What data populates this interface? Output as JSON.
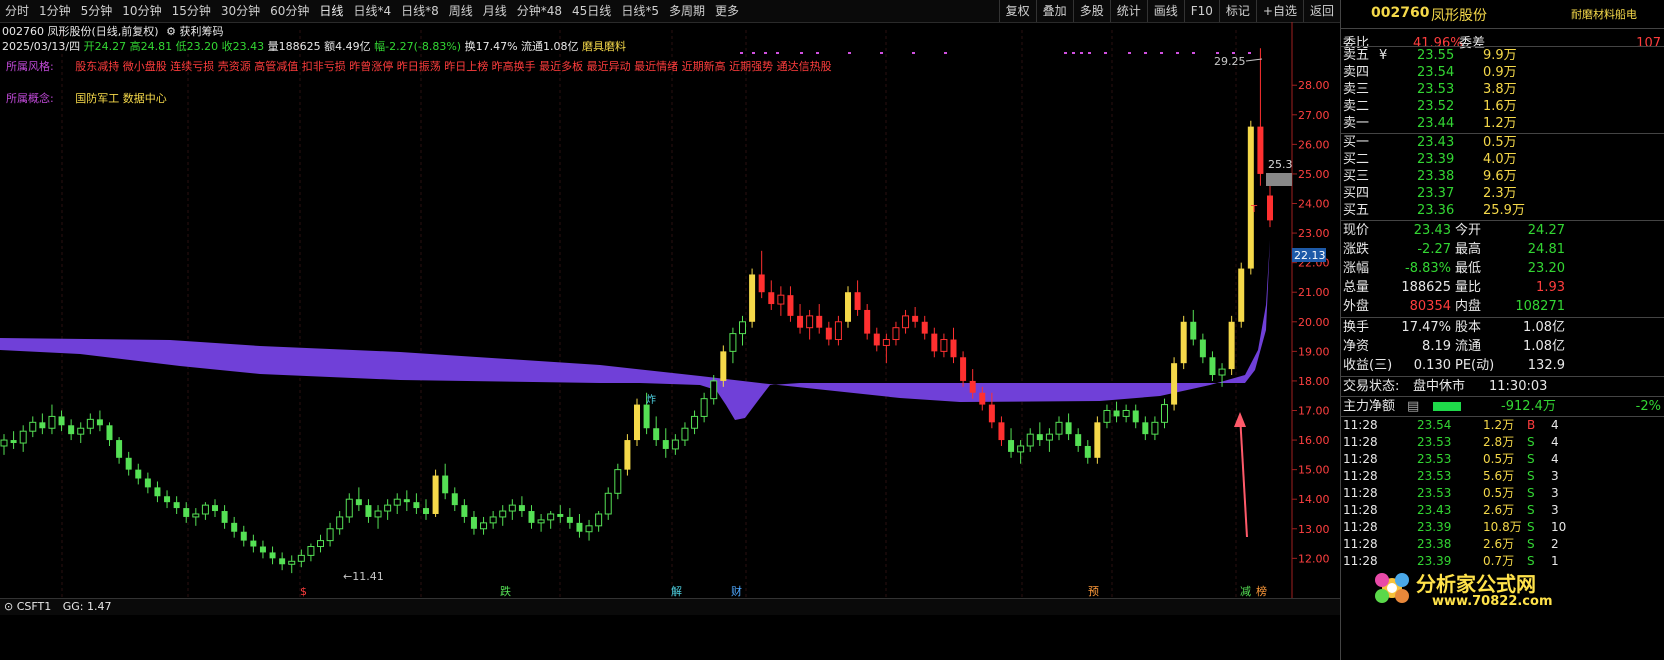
{
  "toolbar": {
    "periods": [
      "分时",
      "1分钟",
      "5分钟",
      "10分钟",
      "15分钟",
      "30分钟",
      "60分钟",
      "日线",
      "日线*4",
      "日线*8",
      "周线",
      "月线",
      "分钟*48",
      "45日线",
      "日线*5",
      "多周期",
      "更多"
    ],
    "tools": [
      "复权",
      "叠加",
      "多股",
      "统计",
      "画线",
      "F10",
      "标记",
      "+自选",
      "返回"
    ]
  },
  "info": {
    "stock": "002760 凤形股份(日线,前复权)",
    "indicator": "获利筹码",
    "date": "2025/03/13/四",
    "open": "开24.27",
    "high": "高24.81",
    "low": "低23.20",
    "close": "收23.43",
    "volume": "量188625",
    "amount": "额4.49亿",
    "change": "幅-2.27(-8.83%)",
    "turnover": "换17.47%",
    "float": "流通1.08亿",
    "sector": "磨具磨料"
  },
  "style_label": "所属风格:",
  "style_tags": "股东减持 微小盘股 连续亏损 壳资源 高管减值 扣非亏损 昨曾涨停 昨日振荡 昨日上榜 昨高换手 最近多板 最近异动 最近情绪 近期新高 近期强势 通达信热股",
  "concept_label": "所属概念:",
  "concept_tags": "国防军工 数据中心",
  "chart_labels": {
    "high_price": "29.25",
    "right_box": "25.3",
    "low_mark": "←11.41",
    "current_price": "22.13",
    "event_s": "$",
    "event_die": "跌",
    "event_jie": "解",
    "event_cai": "财",
    "event_yu": "预",
    "event_jian": "减",
    "event_bang": "榜",
    "zha": "炸",
    "t_mark": "T"
  },
  "chart_data": {
    "type": "candlestick",
    "ylim": [
      11.2,
      29.8
    ],
    "yticks": [
      "28.00",
      "27.00",
      "26.00",
      "25.00",
      "24.00",
      "23.00",
      "22.00",
      "21.00",
      "20.00",
      "19.00",
      "18.00",
      "17.00",
      "16.00",
      "15.00",
      "14.00",
      "13.00",
      "12.00"
    ],
    "ytick_values": [
      28,
      27,
      26,
      25,
      24,
      23,
      22,
      21,
      20,
      19,
      18,
      17,
      16,
      15,
      14,
      13,
      12
    ],
    "candles_ohlc": [
      [
        15.8,
        16.2,
        15.5,
        16.0
      ],
      [
        16.0,
        16.3,
        15.7,
        15.9
      ],
      [
        15.9,
        16.5,
        15.6,
        16.3
      ],
      [
        16.3,
        16.8,
        16.1,
        16.6
      ],
      [
        16.6,
        16.9,
        16.2,
        16.4
      ],
      [
        16.4,
        17.2,
        16.2,
        16.8
      ],
      [
        16.8,
        17.0,
        16.3,
        16.5
      ],
      [
        16.5,
        16.7,
        16.0,
        16.2
      ],
      [
        16.2,
        16.6,
        15.9,
        16.4
      ],
      [
        16.4,
        16.9,
        16.2,
        16.7
      ],
      [
        16.7,
        17.0,
        16.3,
        16.5
      ],
      [
        16.5,
        16.6,
        15.8,
        16.0
      ],
      [
        16.0,
        16.1,
        15.2,
        15.4
      ],
      [
        15.4,
        15.6,
        14.8,
        15.0
      ],
      [
        15.0,
        15.2,
        14.5,
        14.7
      ],
      [
        14.7,
        14.9,
        14.2,
        14.4
      ],
      [
        14.4,
        14.6,
        13.9,
        14.1
      ],
      [
        14.1,
        14.3,
        13.7,
        13.9
      ],
      [
        13.9,
        14.1,
        13.5,
        13.7
      ],
      [
        13.7,
        13.9,
        13.2,
        13.4
      ],
      [
        13.4,
        13.7,
        13.1,
        13.5
      ],
      [
        13.5,
        13.9,
        13.3,
        13.8
      ],
      [
        13.8,
        14.0,
        13.4,
        13.6
      ],
      [
        13.6,
        13.8,
        13.0,
        13.2
      ],
      [
        13.2,
        13.4,
        12.7,
        12.9
      ],
      [
        12.9,
        13.1,
        12.4,
        12.6
      ],
      [
        12.6,
        12.8,
        12.2,
        12.4
      ],
      [
        12.4,
        12.6,
        12.0,
        12.2
      ],
      [
        12.2,
        12.4,
        11.8,
        12.0
      ],
      [
        12.0,
        12.2,
        11.6,
        11.8
      ],
      [
        11.8,
        12.1,
        11.5,
        11.9
      ],
      [
        11.9,
        12.3,
        11.7,
        12.1
      ],
      [
        12.1,
        12.5,
        11.9,
        12.4
      ],
      [
        12.4,
        12.8,
        12.2,
        12.6
      ],
      [
        12.6,
        13.2,
        12.4,
        13.0
      ],
      [
        13.0,
        13.6,
        12.8,
        13.4
      ],
      [
        13.4,
        14.2,
        13.2,
        14.0
      ],
      [
        14.0,
        14.4,
        13.6,
        13.8
      ],
      [
        13.8,
        14.0,
        13.2,
        13.4
      ],
      [
        13.4,
        13.8,
        13.0,
        13.6
      ],
      [
        13.6,
        14.0,
        13.3,
        13.8
      ],
      [
        13.8,
        14.2,
        13.5,
        14.0
      ],
      [
        14.0,
        14.3,
        13.6,
        13.9
      ],
      [
        13.9,
        14.2,
        13.5,
        13.7
      ],
      [
        13.7,
        14.0,
        13.3,
        13.5
      ],
      [
        13.5,
        15.0,
        13.4,
        14.8
      ],
      [
        14.8,
        15.2,
        14.0,
        14.2
      ],
      [
        14.2,
        14.4,
        13.6,
        13.8
      ],
      [
        13.8,
        14.0,
        13.2,
        13.4
      ],
      [
        13.4,
        13.6,
        12.8,
        13.0
      ],
      [
        13.0,
        13.4,
        12.8,
        13.2
      ],
      [
        13.2,
        13.6,
        13.0,
        13.4
      ],
      [
        13.4,
        13.8,
        13.1,
        13.6
      ],
      [
        13.6,
        14.0,
        13.3,
        13.8
      ],
      [
        13.8,
        14.1,
        13.4,
        13.6
      ],
      [
        13.6,
        13.8,
        13.0,
        13.2
      ],
      [
        13.2,
        13.5,
        12.9,
        13.3
      ],
      [
        13.3,
        13.6,
        13.0,
        13.5
      ],
      [
        13.5,
        13.8,
        13.2,
        13.4
      ],
      [
        13.4,
        13.7,
        13.0,
        13.2
      ],
      [
        13.2,
        13.5,
        12.7,
        12.9
      ],
      [
        12.9,
        13.3,
        12.6,
        13.1
      ],
      [
        13.1,
        13.6,
        12.9,
        13.5
      ],
      [
        13.5,
        14.4,
        13.3,
        14.2
      ],
      [
        14.2,
        15.2,
        14.0,
        15.0
      ],
      [
        15.0,
        16.2,
        14.8,
        16.0
      ],
      [
        16.0,
        17.4,
        15.8,
        17.2
      ],
      [
        17.2,
        17.6,
        16.2,
        16.4
      ],
      [
        16.4,
        16.8,
        15.8,
        16.0
      ],
      [
        16.0,
        16.4,
        15.4,
        15.7
      ],
      [
        15.7,
        16.2,
        15.5,
        16.0
      ],
      [
        16.0,
        16.6,
        15.8,
        16.4
      ],
      [
        16.4,
        17.0,
        16.2,
        16.8
      ],
      [
        16.8,
        17.6,
        16.6,
        17.4
      ],
      [
        17.4,
        18.2,
        17.2,
        18.0
      ],
      [
        18.0,
        19.2,
        17.8,
        19.0
      ],
      [
        19.0,
        19.8,
        18.6,
        19.6
      ],
      [
        19.6,
        20.2,
        19.2,
        20.0
      ],
      [
        20.0,
        21.8,
        19.8,
        21.6
      ],
      [
        21.6,
        22.4,
        20.8,
        21.0
      ],
      [
        21.0,
        21.4,
        20.4,
        20.6
      ],
      [
        20.6,
        21.2,
        20.2,
        20.9
      ],
      [
        20.9,
        21.2,
        20.0,
        20.2
      ],
      [
        20.2,
        20.6,
        19.6,
        19.8
      ],
      [
        19.8,
        20.4,
        19.4,
        20.2
      ],
      [
        20.2,
        20.6,
        19.6,
        19.8
      ],
      [
        19.8,
        20.0,
        19.2,
        19.4
      ],
      [
        19.4,
        20.2,
        19.2,
        20.0
      ],
      [
        20.0,
        21.2,
        19.8,
        21.0
      ],
      [
        21.0,
        21.4,
        20.2,
        20.4
      ],
      [
        20.4,
        20.6,
        19.4,
        19.6
      ],
      [
        19.6,
        19.8,
        19.0,
        19.2
      ],
      [
        19.2,
        19.6,
        18.6,
        19.4
      ],
      [
        19.4,
        20.0,
        19.2,
        19.8
      ],
      [
        19.8,
        20.4,
        19.6,
        20.2
      ],
      [
        20.2,
        20.5,
        19.8,
        20.0
      ],
      [
        20.0,
        20.2,
        19.4,
        19.6
      ],
      [
        19.6,
        19.8,
        18.8,
        19.0
      ],
      [
        19.0,
        19.6,
        18.8,
        19.4
      ],
      [
        19.4,
        19.8,
        18.6,
        18.8
      ],
      [
        18.8,
        19.0,
        17.8,
        18.0
      ],
      [
        18.0,
        18.4,
        17.4,
        17.6
      ],
      [
        17.6,
        17.8,
        17.0,
        17.2
      ],
      [
        17.2,
        17.6,
        16.4,
        16.6
      ],
      [
        16.6,
        16.8,
        15.8,
        16.0
      ],
      [
        16.0,
        16.4,
        15.4,
        15.6
      ],
      [
        15.6,
        16.0,
        15.2,
        15.8
      ],
      [
        15.8,
        16.4,
        15.6,
        16.2
      ],
      [
        16.2,
        16.6,
        15.8,
        16.0
      ],
      [
        16.0,
        16.4,
        15.6,
        16.2
      ],
      [
        16.2,
        16.8,
        16.0,
        16.6
      ],
      [
        16.6,
        16.9,
        16.0,
        16.2
      ],
      [
        16.2,
        16.4,
        15.6,
        15.8
      ],
      [
        15.8,
        16.0,
        15.2,
        15.4
      ],
      [
        15.4,
        16.8,
        15.2,
        16.6
      ],
      [
        16.6,
        17.2,
        16.4,
        17.0
      ],
      [
        17.0,
        17.3,
        16.6,
        16.8
      ],
      [
        16.8,
        17.2,
        16.6,
        17.0
      ],
      [
        17.0,
        17.2,
        16.4,
        16.6
      ],
      [
        16.6,
        16.8,
        16.0,
        16.2
      ],
      [
        16.2,
        16.8,
        16.0,
        16.6
      ],
      [
        16.6,
        17.4,
        16.4,
        17.2
      ],
      [
        17.2,
        18.8,
        17.0,
        18.6
      ],
      [
        18.6,
        20.2,
        18.4,
        20.0
      ],
      [
        20.0,
        20.4,
        19.2,
        19.4
      ],
      [
        19.4,
        19.6,
        18.6,
        18.8
      ],
      [
        18.8,
        19.0,
        18.0,
        18.2
      ],
      [
        18.2,
        18.6,
        17.8,
        18.4
      ],
      [
        18.4,
        20.2,
        18.2,
        20.0
      ],
      [
        20.0,
        22.0,
        19.8,
        21.8
      ],
      [
        21.8,
        26.8,
        21.6,
        26.6
      ],
      [
        26.6,
        29.25,
        24.6,
        25.0
      ],
      [
        24.27,
        24.81,
        23.2,
        23.43
      ]
    ]
  },
  "bottom": {
    "indicator": "CSFT1",
    "value": "GG: 1.47"
  },
  "panel": {
    "code": "002760",
    "name": "凤形股份",
    "tag": "耐磨材料船电",
    "wei_label": "委比",
    "wei_value": "41.96%",
    "weicha_label": "委差",
    "weicha_value": "107",
    "asks": [
      {
        "label": "卖五",
        "mark": "¥",
        "price": "23.55",
        "vol": "9.9万"
      },
      {
        "label": "卖四",
        "mark": "",
        "price": "23.54",
        "vol": "0.9万"
      },
      {
        "label": "卖三",
        "mark": "",
        "price": "23.53",
        "vol": "3.8万"
      },
      {
        "label": "卖二",
        "mark": "",
        "price": "23.52",
        "vol": "1.6万"
      },
      {
        "label": "卖一",
        "mark": "",
        "price": "23.44",
        "vol": "1.2万"
      }
    ],
    "bids": [
      {
        "label": "买一",
        "price": "23.43",
        "vol": "0.5万"
      },
      {
        "label": "买二",
        "price": "23.39",
        "vol": "4.0万"
      },
      {
        "label": "买三",
        "price": "23.38",
        "vol": "9.6万"
      },
      {
        "label": "买四",
        "price": "23.37",
        "vol": "2.3万"
      },
      {
        "label": "买五",
        "price": "23.36",
        "vol": "25.9万"
      }
    ],
    "stats": [
      {
        "l1": "现价",
        "v1": "23.43",
        "c1": "green",
        "l2": "今开",
        "v2": "24.27",
        "c2": "green"
      },
      {
        "l1": "涨跌",
        "v1": "-2.27",
        "c1": "green",
        "l2": "最高",
        "v2": "24.81",
        "c2": "green"
      },
      {
        "l1": "涨幅",
        "v1": "-8.83%",
        "c1": "green",
        "l2": "最低",
        "v2": "23.20",
        "c2": "green"
      },
      {
        "l1": "总量",
        "v1": "188625",
        "c1": "white",
        "l2": "量比",
        "v2": "1.93",
        "c2": "red"
      },
      {
        "l1": "外盘",
        "v1": "80354",
        "c1": "red",
        "l2": "内盘",
        "v2": "108271",
        "c2": "green"
      }
    ],
    "stats2": [
      {
        "l1": "换手",
        "v1": "17.47%",
        "l2": "股本",
        "v2": "1.08亿"
      },
      {
        "l1": "净资",
        "v1": "8.19",
        "l2": "流通",
        "v2": "1.08亿"
      },
      {
        "l1": "收益(三)",
        "v1": "0.130",
        "l2": "PE(动)",
        "v2": "132.9"
      }
    ],
    "trade_status_label": "交易状态:",
    "trade_status": "盘中休市",
    "trade_time": "11:30:03",
    "main_label": "主力净额",
    "main_value": "-912.4万",
    "main_pct": "-2%",
    "ticks": [
      {
        "t": "11:28",
        "p": "23.54",
        "v": "1.2万",
        "bs": "B",
        "n": "4"
      },
      {
        "t": "11:28",
        "p": "23.53",
        "v": "2.8万",
        "bs": "S",
        "n": "4"
      },
      {
        "t": "11:28",
        "p": "23.53",
        "v": "0.5万",
        "bs": "S",
        "n": "4"
      },
      {
        "t": "11:28",
        "p": "23.53",
        "v": "5.6万",
        "bs": "S",
        "n": "3"
      },
      {
        "t": "11:28",
        "p": "23.53",
        "v": "0.5万",
        "bs": "S",
        "n": "3"
      },
      {
        "t": "11:28",
        "p": "23.43",
        "v": "2.6万",
        "bs": "S",
        "n": "3"
      },
      {
        "t": "11:28",
        "p": "23.39",
        "v": "10.8万",
        "bs": "S",
        "n": "10"
      },
      {
        "t": "11:28",
        "p": "23.38",
        "v": "2.6万",
        "bs": "S",
        "n": "2"
      },
      {
        "t": "11:28",
        "p": "23.39",
        "v": "0.7万",
        "bs": "S",
        "n": "1"
      }
    ]
  },
  "watermark": {
    "title": "分析家公式网",
    "url": "www.70822.com"
  }
}
